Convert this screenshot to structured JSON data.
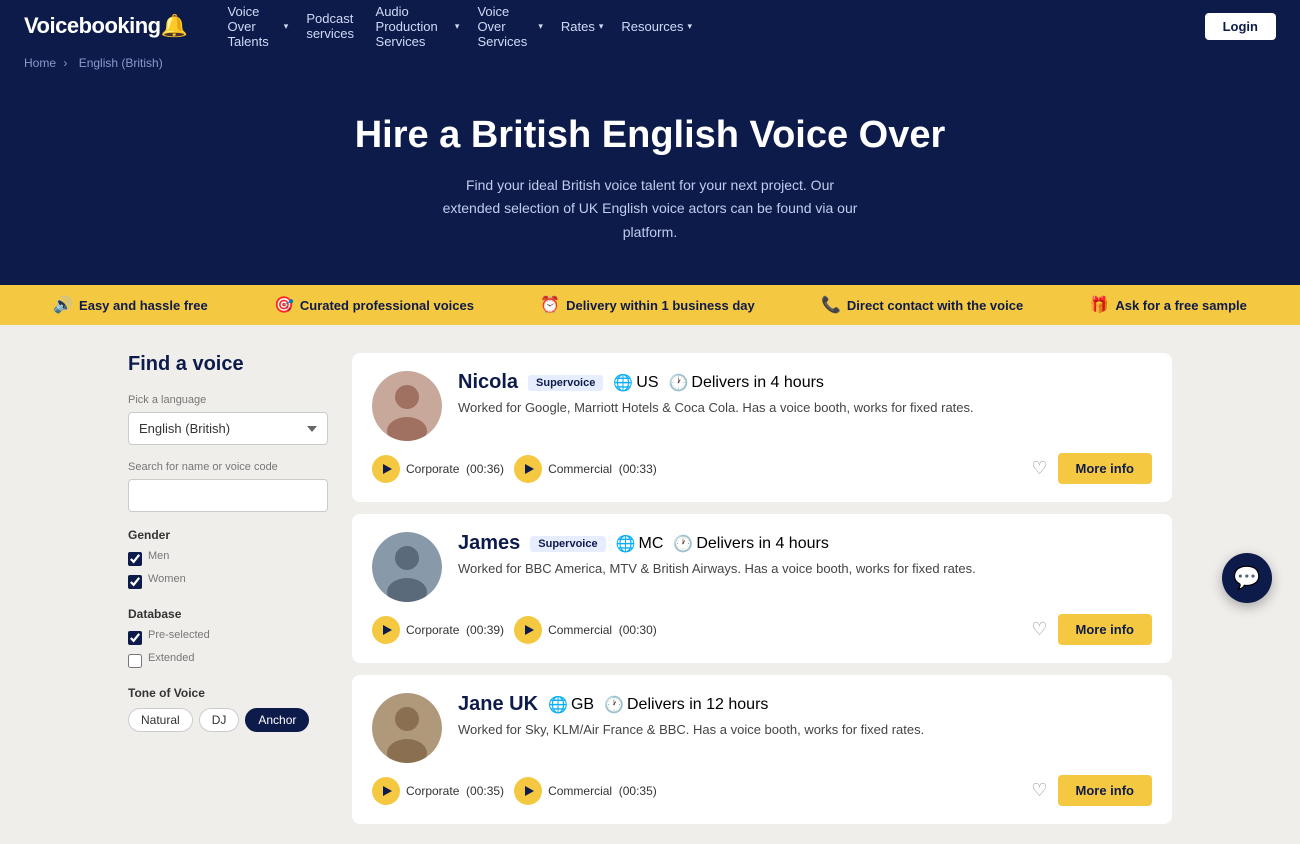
{
  "brand": {
    "logo_text": "Voicebooking",
    "logo_emoji": "🔔"
  },
  "nav": {
    "links": [
      {
        "label": "Voice Over Talents",
        "has_arrow": true
      },
      {
        "label": "Podcast services",
        "has_arrow": false
      },
      {
        "label": "Audio Production Services",
        "has_arrow": true
      },
      {
        "label": "Voice Over Services",
        "has_arrow": true
      },
      {
        "label": "Rates",
        "has_arrow": true
      },
      {
        "label": "Resources",
        "has_arrow": true
      }
    ],
    "login_label": "Login"
  },
  "breadcrumb": {
    "home": "Home",
    "separator": "›",
    "current": "English (British)"
  },
  "hero": {
    "title_plain": "Hire a British English Voice Over",
    "description": "Find your ideal British voice talent for your next project. Our extended selection of UK English voice actors can be found via our platform."
  },
  "features": [
    {
      "icon": "🔊",
      "label": "Easy and hassle free"
    },
    {
      "icon": "🎯",
      "label": "Curated professional voices"
    },
    {
      "icon": "⏰",
      "label": "Delivery within 1 business day"
    },
    {
      "icon": "📞",
      "label": "Direct contact with the voice"
    },
    {
      "icon": "🎁",
      "label": "Ask for a free sample"
    }
  ],
  "sidebar": {
    "title": "Find a voice",
    "language_label": "Pick a language",
    "language_value": "English (British)",
    "search_label": "Search for name or voice code",
    "search_placeholder": "",
    "gender_label": "Gender",
    "genders": [
      {
        "label": "Men",
        "checked": true
      },
      {
        "label": "Women",
        "checked": true
      }
    ],
    "database_label": "Database",
    "databases": [
      {
        "label": "Pre-selected",
        "checked": true
      },
      {
        "label": "Extended",
        "checked": false
      }
    ],
    "tone_label": "Tone of Voice",
    "tones": [
      {
        "label": "Natural",
        "active": false
      },
      {
        "label": "DJ",
        "active": false
      },
      {
        "label": "Anchor",
        "active": true
      }
    ]
  },
  "voices": [
    {
      "name": "Nicola",
      "badge": "Supervoice",
      "flag": "US",
      "delivery": "Delivers in 4 hours",
      "description": "Worked for Google, Marriott Hotels & Coca Cola. Has a voice booth, works for fixed rates.",
      "tracks": [
        {
          "type": "Corporate",
          "duration": "00:36"
        },
        {
          "type": "Commercial",
          "duration": "00:33"
        }
      ],
      "more_label": "More info",
      "avatar_color": "#c8a89a"
    },
    {
      "name": "James",
      "badge": "Supervoice",
      "flag": "MC",
      "delivery": "Delivers in 4 hours",
      "description": "Worked for BBC America, MTV & British Airways. Has a voice booth, works for fixed rates.",
      "tracks": [
        {
          "type": "Corporate",
          "duration": "00:39"
        },
        {
          "type": "Commercial",
          "duration": "00:30"
        }
      ],
      "more_label": "More info",
      "avatar_color": "#8899aa"
    },
    {
      "name": "Jane UK",
      "badge": "",
      "flag": "GB",
      "delivery": "Delivers in 12 hours",
      "description": "Worked for Sky, KLM/Air France & BBC. Has a voice booth, works for fixed rates.",
      "tracks": [
        {
          "type": "Corporate",
          "duration": "00:35"
        },
        {
          "type": "Commercial",
          "duration": "00:35"
        }
      ],
      "more_label": "More info",
      "avatar_color": "#b0987a"
    }
  ]
}
